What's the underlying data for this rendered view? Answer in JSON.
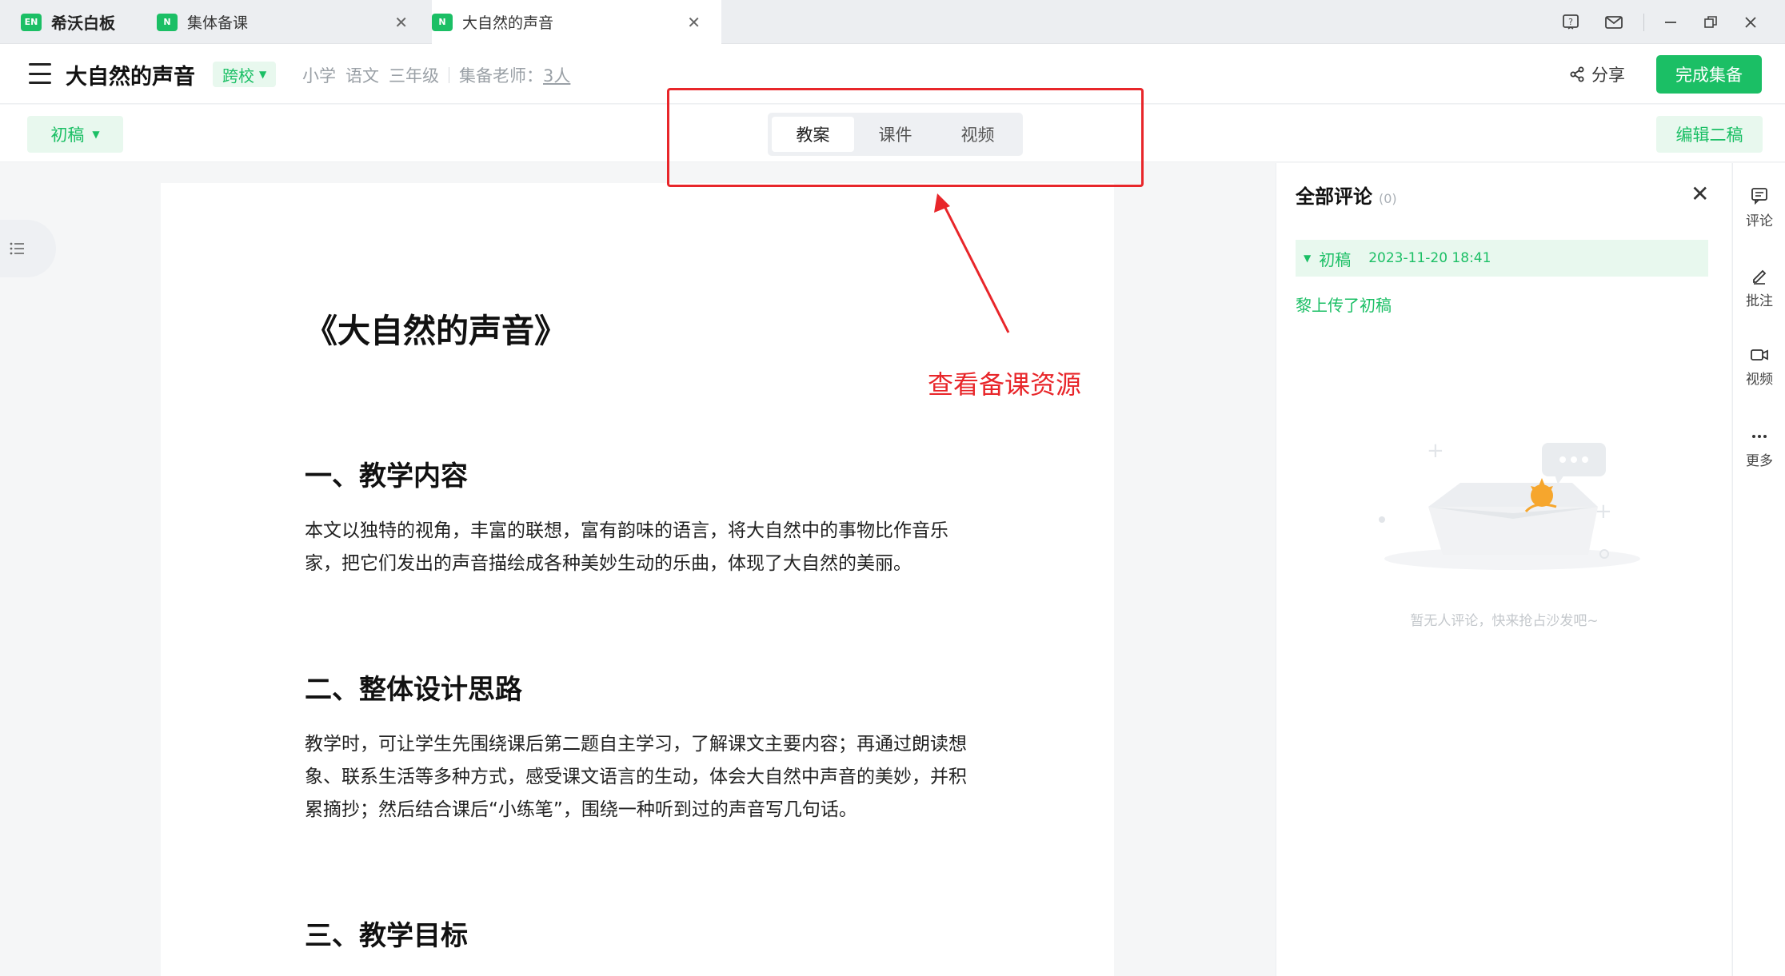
{
  "titlebar": {
    "brand": {
      "logo": "EN",
      "label": "希沃白板"
    },
    "tabs": [
      {
        "logo": "N",
        "label": "集体备课"
      },
      {
        "logo": "N",
        "label": "大自然的声音"
      }
    ],
    "icons": [
      "help-icon",
      "mail-icon",
      "minimize-icon",
      "restore-icon",
      "close-icon"
    ]
  },
  "header": {
    "title": "大自然的声音",
    "cross_tag": "跨校",
    "meta": {
      "level": "小学",
      "subject": "语文",
      "grade": "三年级",
      "teacher_label": "集备老师：",
      "teacher_count": "3人"
    },
    "share_label": "分享",
    "finish_label": "完成集备"
  },
  "toolbar": {
    "draft_label": "初稿",
    "tabs": [
      "教案",
      "课件",
      "视频"
    ],
    "active_tab": 0,
    "edit2_label": "编辑二稿"
  },
  "document": {
    "title": "《大自然的声音》",
    "sections": [
      {
        "heading": "一、教学内容",
        "paragraph": "本文以独特的视角，丰富的联想，富有韵味的语言，将大自然中的事物比作音乐家，把它们发出的声音描绘成各种美妙生动的乐曲，体现了大自然的美丽。"
      },
      {
        "heading": "二、整体设计思路",
        "paragraph": "教学时，可让学生先围绕课后第二题自主学习，了解课文主要内容；再通过朗读想象、联系生活等多种方式，感受课文语言的生动，体会大自然中声音的美妙，并积累摘抄；然后结合课后“小练笔”，围绕一种听到过的声音写几句话。"
      },
      {
        "heading": "三、教学目标",
        "paragraph": ""
      }
    ]
  },
  "annotation": {
    "text": "查看备课资源",
    "color": "#e8262a"
  },
  "comments": {
    "title": "全部评论",
    "count": "(0)",
    "draft": {
      "name": "初稿",
      "time": "2023-11-20 18:41"
    },
    "upload_note": "黎上传了初稿",
    "empty_text": "暂无人评论，快来抢占沙发吧~"
  },
  "rail": [
    {
      "icon": "comment-icon",
      "label": "评论"
    },
    {
      "icon": "annotate-icon",
      "label": "批注"
    },
    {
      "icon": "video-icon",
      "label": "视频"
    },
    {
      "icon": "more-icon",
      "label": "更多"
    }
  ],
  "colors": {
    "brand_green": "#1bbf65",
    "light_green": "#e8f8ee",
    "annotation_red": "#e8262a"
  }
}
